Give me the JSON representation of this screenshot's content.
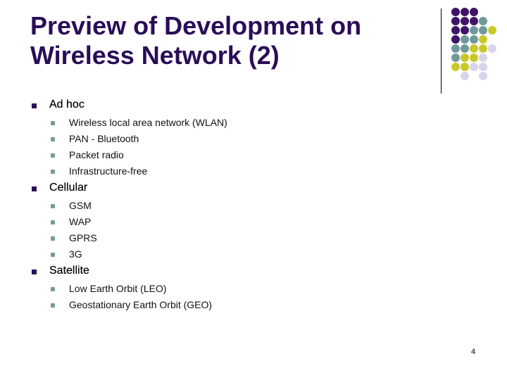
{
  "slide": {
    "title_lines": [
      "Preview of Development on",
      "Wireless Network (2)"
    ],
    "page_number": "4",
    "colors": {
      "title": "#2a0d57",
      "bullet_level1": "#2a0d57",
      "bullet_level2": "#7a9a9e",
      "dot_purple": "#3f1468",
      "dot_teal": "#6f9a9c",
      "dot_yellow": "#c9c82a",
      "dot_lavender": "#d5d6ea"
    },
    "decoration": {
      "dot_grid_rows": [
        "PPP",
        "PPPT",
        "PPTTY",
        "PTTY",
        "TTYYL",
        "TYYL",
        "YYLL",
        "_L_L"
      ]
    },
    "sections": [
      {
        "heading": "Ad hoc",
        "items": [
          "Wireless local area network (WLAN)",
          "PAN - Bluetooth",
          "Packet radio",
          "Infrastructure-free"
        ]
      },
      {
        "heading": "Cellular",
        "items": [
          "GSM",
          "WAP",
          "GPRS",
          "3G"
        ]
      },
      {
        "heading": "Satellite",
        "items": [
          "Low Earth Orbit (LEO)",
          "Geostationary Earth Orbit (GEO)"
        ]
      }
    ]
  }
}
